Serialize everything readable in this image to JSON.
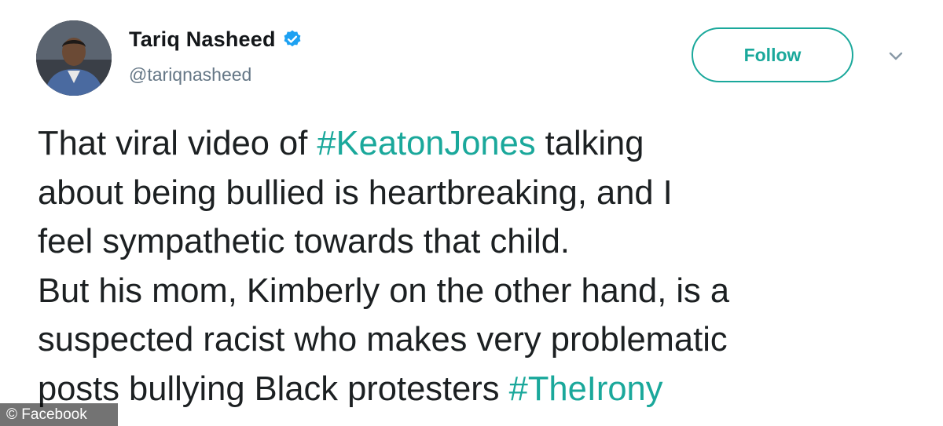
{
  "author": {
    "display_name": "Tariq Nasheed",
    "handle": "@tariqnasheed",
    "verified": true,
    "avatar_icon": "user-avatar-photo"
  },
  "actions": {
    "follow_label": "Follow",
    "more_icon": "chevron-down-icon"
  },
  "tweet": {
    "lines": [
      [
        {
          "text": "That viral video of "
        },
        {
          "text": "#KeatonJones",
          "hashtag": true
        },
        {
          "text": " talking"
        }
      ],
      [
        {
          "text": "about being bullied is heartbreaking, and I"
        }
      ],
      [
        {
          "text": "feel sympathetic towards that child."
        }
      ],
      [
        {
          "text": "But his mom, Kimberly on the other hand, is a"
        }
      ],
      [
        {
          "text": "suspected racist who makes very problematic"
        }
      ],
      [
        {
          "text": "posts bullying Black protesters "
        },
        {
          "text": "#TheIrony",
          "hashtag": true
        }
      ]
    ]
  },
  "watermark": {
    "text": "© Facebook"
  },
  "colors": {
    "accent": "#1aa89b",
    "verified_blue": "#1da1f2",
    "text": "#1c2022",
    "muted": "#657786"
  }
}
